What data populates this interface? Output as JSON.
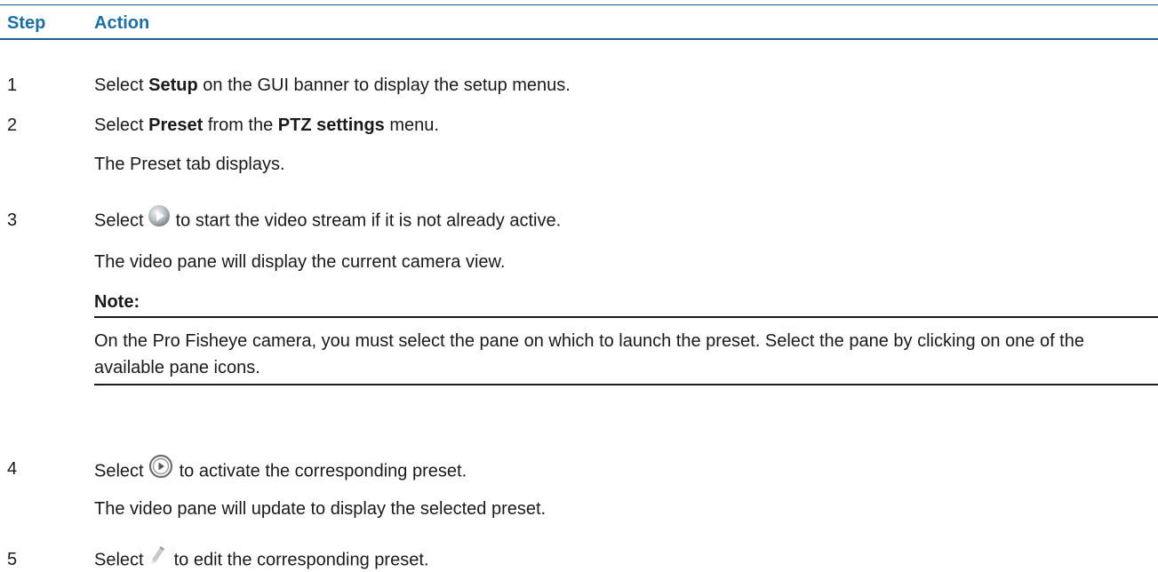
{
  "header": {
    "step": "Step",
    "action": "Action"
  },
  "steps": [
    {
      "num": "1",
      "pre": "Select ",
      "bold1": "Setup",
      "post": " on the GUI banner to display the setup menus."
    },
    {
      "num": "2",
      "pre": "Select ",
      "bold1": "Preset",
      "mid": " from the ",
      "bold2": "PTZ settings",
      "post": " menu.",
      "result": "The Preset tab displays."
    },
    {
      "num": "3",
      "pre": "Select",
      "icon": "play-stream-icon",
      "post": "to start the video stream if it is not already active.",
      "result": "The video pane will display the current camera view.",
      "note_label": "Note:",
      "note_text": "On the Pro Fisheye camera, you must select the pane on which to launch the preset. Select the pane by clicking on one of the available pane icons."
    },
    {
      "num": "4",
      "pre": "Select",
      "icon": "activate-preset-icon",
      "post": "to activate the corresponding preset.",
      "result": "The video pane will update to display the selected preset."
    },
    {
      "num": "5",
      "pre": "Select",
      "icon": "edit-pencil-icon",
      "post": "to edit the corresponding preset."
    }
  ]
}
